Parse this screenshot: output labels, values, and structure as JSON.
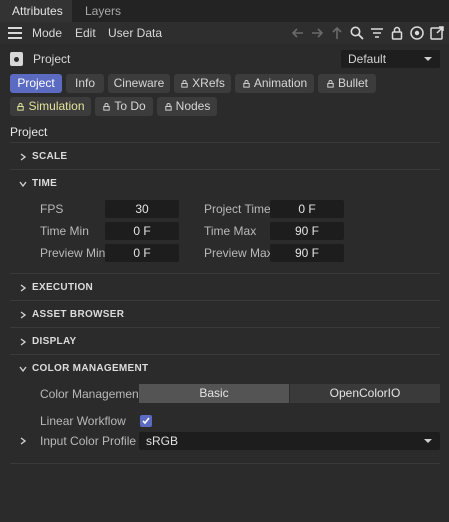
{
  "tabs": [
    {
      "label": "Attributes",
      "active": true
    },
    {
      "label": "Layers",
      "active": false
    }
  ],
  "menu": {
    "items": [
      "Mode",
      "Edit",
      "User Data"
    ],
    "toolbar_icons": [
      "back-arrow-icon",
      "forward-arrow-icon",
      "up-arrow-icon",
      "search-icon",
      "filter-icon",
      "lock-icon",
      "target-icon",
      "new-window-icon"
    ]
  },
  "header": {
    "object_label": "Project",
    "preset_value": "Default"
  },
  "categories": [
    {
      "label": "Project",
      "active": true,
      "icon": false
    },
    {
      "label": "Info",
      "active": false,
      "icon": false
    },
    {
      "label": "Cineware",
      "active": false,
      "icon": false
    },
    {
      "label": "XRefs",
      "active": false,
      "icon": true
    },
    {
      "label": "Animation",
      "active": false,
      "icon": true
    },
    {
      "label": "Bullet",
      "active": false,
      "icon": true
    },
    {
      "label": "Simulation",
      "active": false,
      "icon": true
    },
    {
      "label": "To Do",
      "active": false,
      "icon": true
    },
    {
      "label": "Nodes",
      "active": false,
      "icon": true
    }
  ],
  "section_title": "Project",
  "groups": {
    "scale": "SCALE",
    "time": "TIME",
    "execution": "EXECUTION",
    "asset_browser": "ASSET BROWSER",
    "display": "DISPLAY",
    "color_management": "COLOR MANAGEMENT"
  },
  "time": {
    "fps_label": "FPS",
    "fps_value": "30",
    "project_time_label": "Project Time",
    "project_time_value": "0 F",
    "time_min_label": "Time Min",
    "time_min_value": "0 F",
    "time_max_label": "Time Max",
    "time_max_value": "90 F",
    "preview_min_label": "Preview Min",
    "preview_min_value": "0 F",
    "preview_max_label": "Preview Max",
    "preview_max_value": "90 F"
  },
  "color": {
    "management_label": "Color Management",
    "option_basic": "Basic",
    "option_ocio": "OpenColorIO",
    "selected": "Basic",
    "linear_workflow_label": "Linear Workflow",
    "linear_workflow_checked": true,
    "input_profile_label": "Input Color Profile",
    "input_profile_value": "sRGB"
  },
  "colors": {
    "accent": "#5a6bc1",
    "background": "#2b2b2b",
    "field": "#1d1d1d"
  }
}
